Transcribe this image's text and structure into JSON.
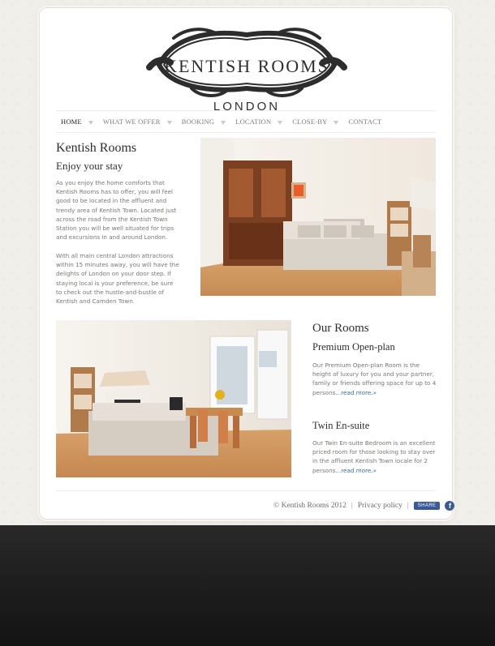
{
  "site": {
    "logo_title": "KENTISH ROOMS",
    "logo_sub": "LONDON"
  },
  "nav": {
    "items": [
      {
        "label": "HOME"
      },
      {
        "label": "WHAT WE OFFER"
      },
      {
        "label": "BOOKING"
      },
      {
        "label": "LOCATION"
      },
      {
        "label": "CLOSE-BY"
      },
      {
        "label": "CONTACT"
      }
    ]
  },
  "intro": {
    "h1": "Kentish Rooms",
    "h2": "Enjoy your stay",
    "p1": "As you enjoy the home comforts that Kentish Rooms has to offer, you will feel good to be located in the affluent and trendy area of Kentish Town. Located just across the road from the Kentish Town Station you will be well situated for trips and excursions in and around London.",
    "p2": "With all main central London attractions within 15 minutes away, you will have the delights of London on your door step. If staying local is your preference, be sure to check out the hustle-and-bustle of Kentish and Camden Town."
  },
  "rooms": {
    "title": "Our Rooms",
    "room1": {
      "title": "Premium Open-plan",
      "text": "Our Premium Open-plan Room is the height of luxury for you and your partner, family or friends offering space for up to 4 persons...",
      "read_more": "read more.»"
    },
    "room2": {
      "title": "Twin En-suite",
      "text": "Our Twin En-suite Bedroom is an excellent priced room for those looking to stay over in the affluent Kentish Town locale for 2 persons...",
      "read_more": "read more.»"
    }
  },
  "footer": {
    "copyright": "© Kentish Rooms 2012",
    "separator": "|",
    "privacy": "Privacy policy",
    "share": "SHARE"
  },
  "colors": {
    "page_bg": "#f1efea",
    "link": "#3a6ea8",
    "facebook": "#3b5998",
    "text_muted": "#7a7773"
  }
}
